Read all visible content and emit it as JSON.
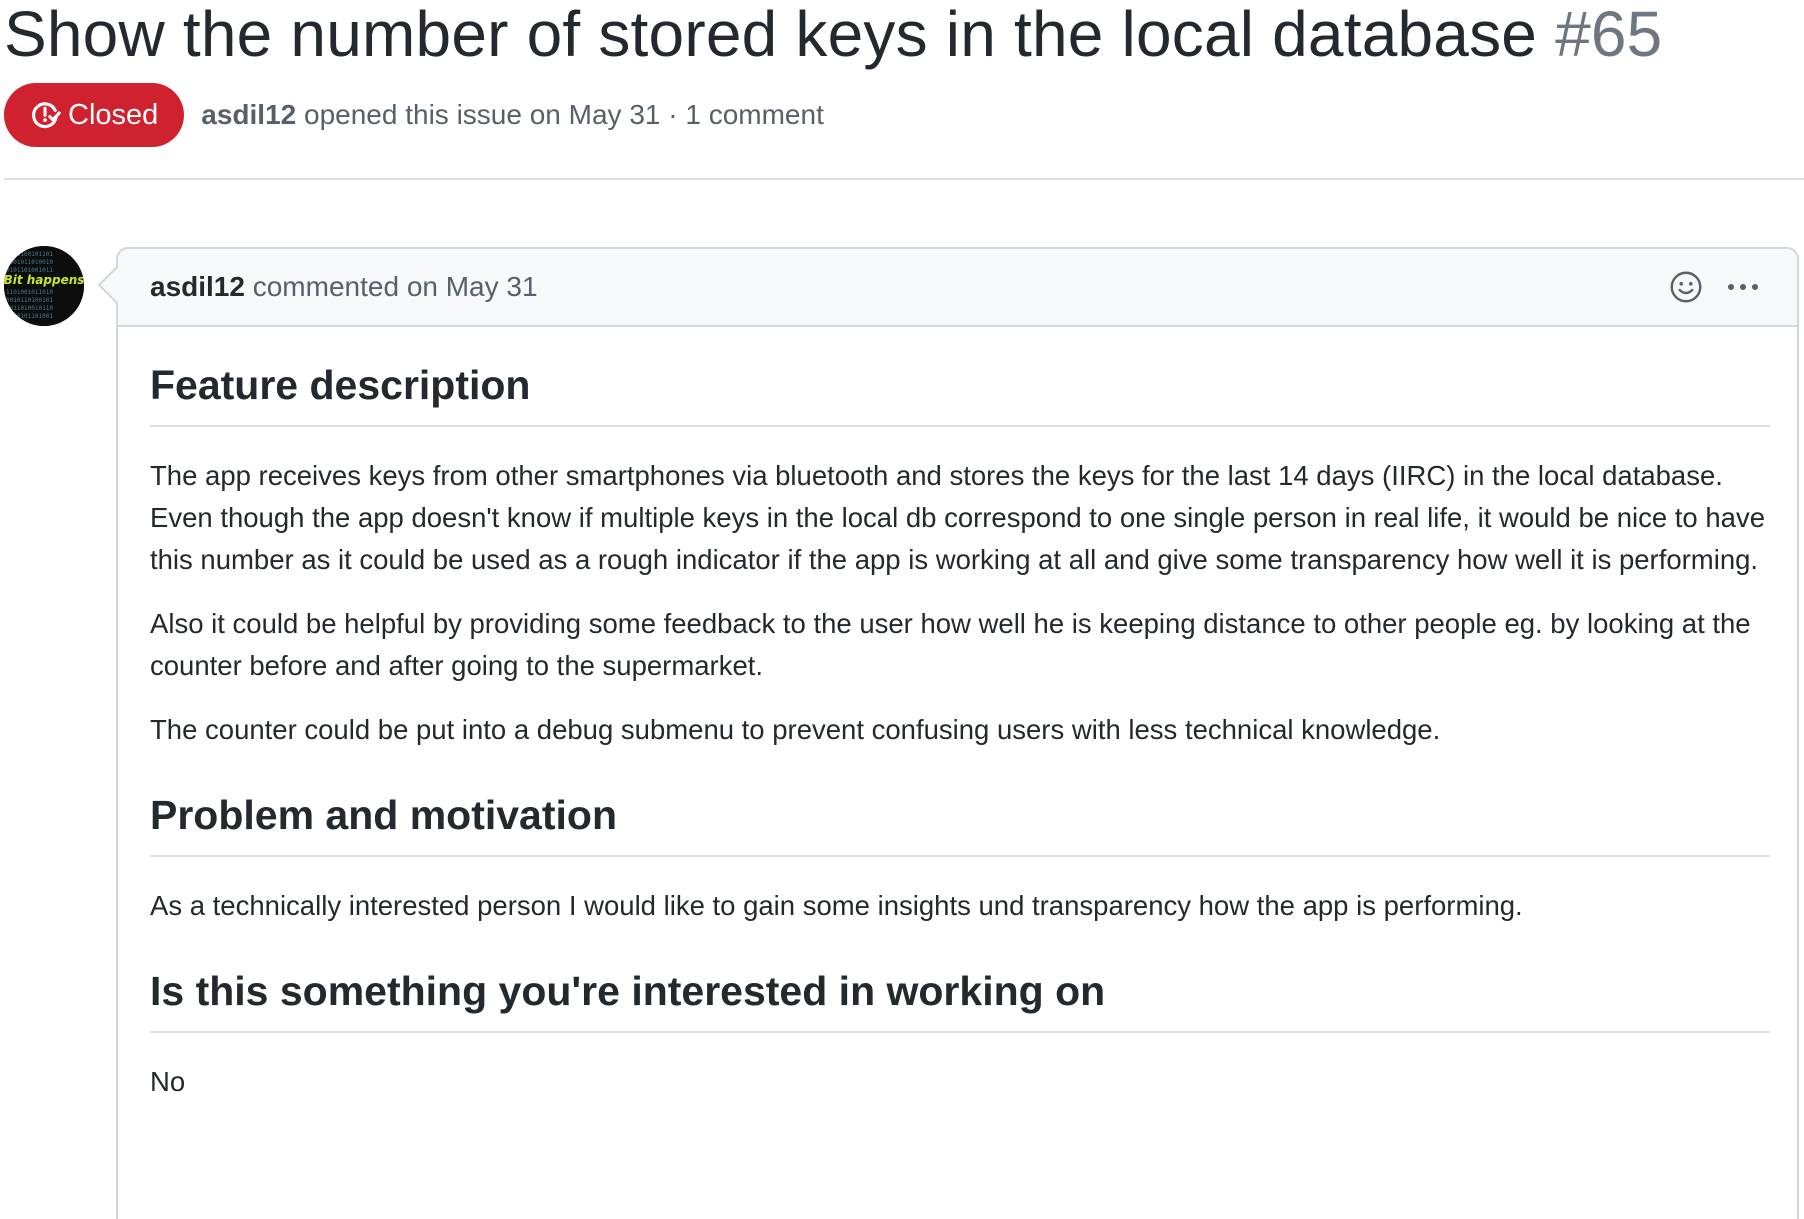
{
  "issue": {
    "title": "Show the number of stored keys in the local database",
    "number": "#65",
    "state": "Closed",
    "state_color": "#cf222e",
    "author": "asdil12",
    "opened_text": "opened this issue on May 31 · 1 comment"
  },
  "comment": {
    "author": "asdil12",
    "action": "commented",
    "date": "on May 31",
    "avatar_text": "Bit happens",
    "sections": [
      {
        "heading": "Feature description",
        "paragraphs": [
          "The app receives keys from other smartphones via bluetooth and stores the keys for the last 14 days (IIRC) in the local database. Even though the app doesn't know if multiple keys in the local db correspond to one single person in real life, it would be nice to have this number as it could be used as a rough indicator if the app is working at all and give some transparency how well it is performing.",
          "Also it could be helpful by providing some feedback to the user how well he is keeping distance to other people eg. by looking at the counter before and after going to the supermarket.",
          "The counter could be put into a debug submenu to prevent confusing users with less technical knowledge."
        ]
      },
      {
        "heading": "Problem and motivation",
        "paragraphs": [
          "As a technically interested person I would like to gain some insights und transparency how the app is performing."
        ]
      },
      {
        "heading": "Is this something you're interested in working on",
        "paragraphs": [
          "No"
        ]
      }
    ]
  },
  "icons": {
    "state": "issue-closed-icon",
    "reaction": "smiley-icon",
    "menu": "kebab-horizontal-icon"
  }
}
